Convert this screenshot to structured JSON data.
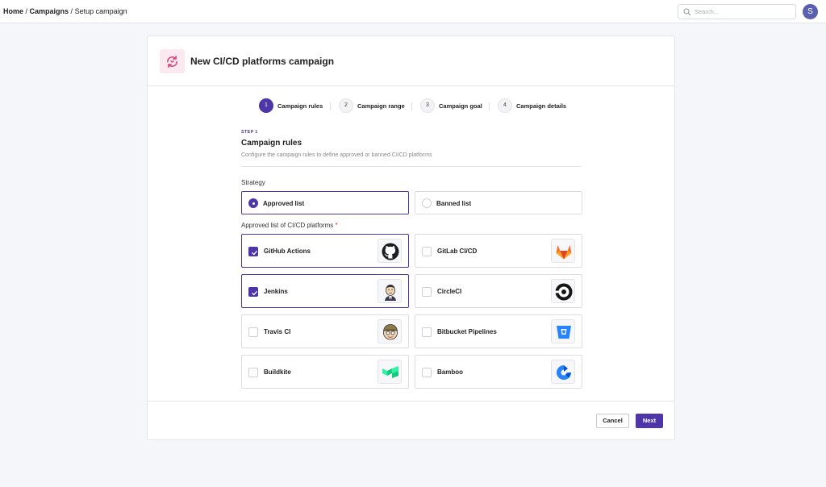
{
  "breadcrumb": {
    "home": "Home",
    "sep1": " / ",
    "campaigns": "Campaigns",
    "sep2": " / ",
    "current": "Setup campaign"
  },
  "search": {
    "placeholder": "Search...",
    "value": "",
    "icon": "search-icon"
  },
  "user": {
    "avatar_initial": "S",
    "avatar_color": "#5a5fb0"
  },
  "card": {
    "title": "New CI/CD platforms campaign",
    "icon": "refresh-cycle-icon",
    "icon_color": "#d6457a"
  },
  "stepper": [
    {
      "num": "1",
      "label": "Campaign rules",
      "active": true
    },
    {
      "num": "2",
      "label": "Campaign range",
      "active": false
    },
    {
      "num": "3",
      "label": "Campaign goal",
      "active": false
    },
    {
      "num": "4",
      "label": "Campaign details",
      "active": false
    }
  ],
  "section": {
    "kicker": "STEP 1",
    "title": "Campaign rules",
    "description": "Configure the campaign rules to define approved or banned CI/CD platforms"
  },
  "strategy": {
    "label": "Strategy",
    "options": [
      {
        "label": "Approved list",
        "selected": true
      },
      {
        "label": "Banned list",
        "selected": false
      }
    ]
  },
  "platforms": {
    "label": "Approved list of CI/CD platforms",
    "required_mark": "*",
    "items": [
      {
        "label": "GitHub Actions",
        "checked": true,
        "icon": "github-icon"
      },
      {
        "label": "GitLab CI/CD",
        "checked": false,
        "icon": "gitlab-icon"
      },
      {
        "label": "Jenkins",
        "checked": true,
        "icon": "jenkins-icon"
      },
      {
        "label": "CircleCI",
        "checked": false,
        "icon": "circleci-icon"
      },
      {
        "label": "Travis CI",
        "checked": false,
        "icon": "travis-ci-icon"
      },
      {
        "label": "Bitbucket Pipelines",
        "checked": false,
        "icon": "bitbucket-icon"
      },
      {
        "label": "Buildkite",
        "checked": false,
        "icon": "buildkite-icon"
      },
      {
        "label": "Bamboo",
        "checked": false,
        "icon": "bamboo-icon"
      }
    ]
  },
  "footer": {
    "cancel_label": "Cancel",
    "next_label": "Next"
  },
  "colors": {
    "accent": "#4e36a8",
    "required": "#dd3333"
  }
}
